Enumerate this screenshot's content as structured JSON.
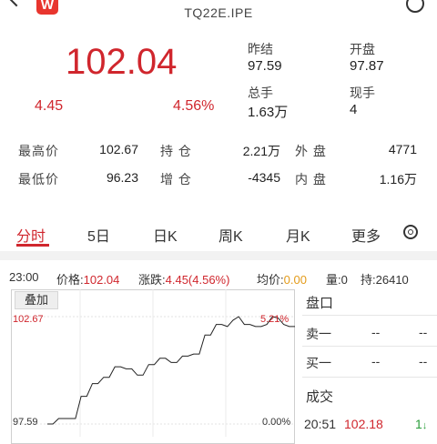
{
  "header": {
    "symbol": "TQ22E.IPE",
    "logo_letter": "W"
  },
  "quote": {
    "price": "102.04",
    "change": "4.45",
    "change_pct": "4.56%"
  },
  "summary": {
    "prev_settle_label": "昨结",
    "prev_settle": "97.59",
    "open_label": "开盘",
    "open": "97.87",
    "total_vol_label": "总手",
    "total_vol": "1.63万",
    "last_vol_label": "现手",
    "last_vol": "4"
  },
  "stats": {
    "high_label": "最高价",
    "high": "102.67",
    "oi_label": "持 仓",
    "oi": "2.21万",
    "outer_label": "外 盘",
    "outer": "4771",
    "low_label": "最低价",
    "low": "96.23",
    "oi_chg_label": "增 仓",
    "oi_chg": "-4345",
    "inner_label": "内 盘",
    "inner": "1.16万"
  },
  "tabs": [
    "分时",
    "5日",
    "日K",
    "周K",
    "月K",
    "更多"
  ],
  "info_line": {
    "time": "23:00",
    "price_label": "价格:",
    "price": "102.04",
    "change_label": "涨跌:",
    "change": "4.45(4.56%)",
    "avg_label": "均价:",
    "avg": "0.00",
    "vol_label": "量:",
    "vol": "0",
    "oi_label": "持:",
    "oi": "26410"
  },
  "chart": {
    "overlay_label": "叠加",
    "y_top": "102.67",
    "y_bottom": "97.59",
    "pct_top": "5.21%",
    "pct_bottom": "0.00%"
  },
  "chart_data": {
    "type": "line",
    "series": [
      {
        "values": [
          97.59,
          97.59,
          97.85,
          97.85,
          97.85,
          97.85,
          98.9,
          98.9,
          99.5,
          99.5,
          99.8,
          99.8,
          100.3,
          100.3,
          100.2,
          100.2,
          99.9,
          99.9,
          100.4,
          100.4,
          100.7,
          100.7,
          100.5,
          100.5,
          100.8,
          100.8,
          100.9,
          100.9,
          101.8,
          101.8,
          102.3,
          102.3,
          102.2,
          102.5,
          102.67,
          102.3,
          102.3,
          102.2,
          102.2,
          102.3,
          102.67,
          102.6,
          102.3,
          102.2,
          102.2
        ]
      }
    ],
    "ylim": [
      97.59,
      102.67
    ]
  },
  "panel": {
    "order_book_label": "盘口",
    "ask1_label": "卖一",
    "ask1_price": "--",
    "ask1_vol": "--",
    "bid1_label": "买一",
    "bid1_price": "--",
    "bid1_vol": "--",
    "trades_label": "成交",
    "trade_time": "20:51",
    "trade_price": "102.18",
    "trade_vol": "1"
  }
}
